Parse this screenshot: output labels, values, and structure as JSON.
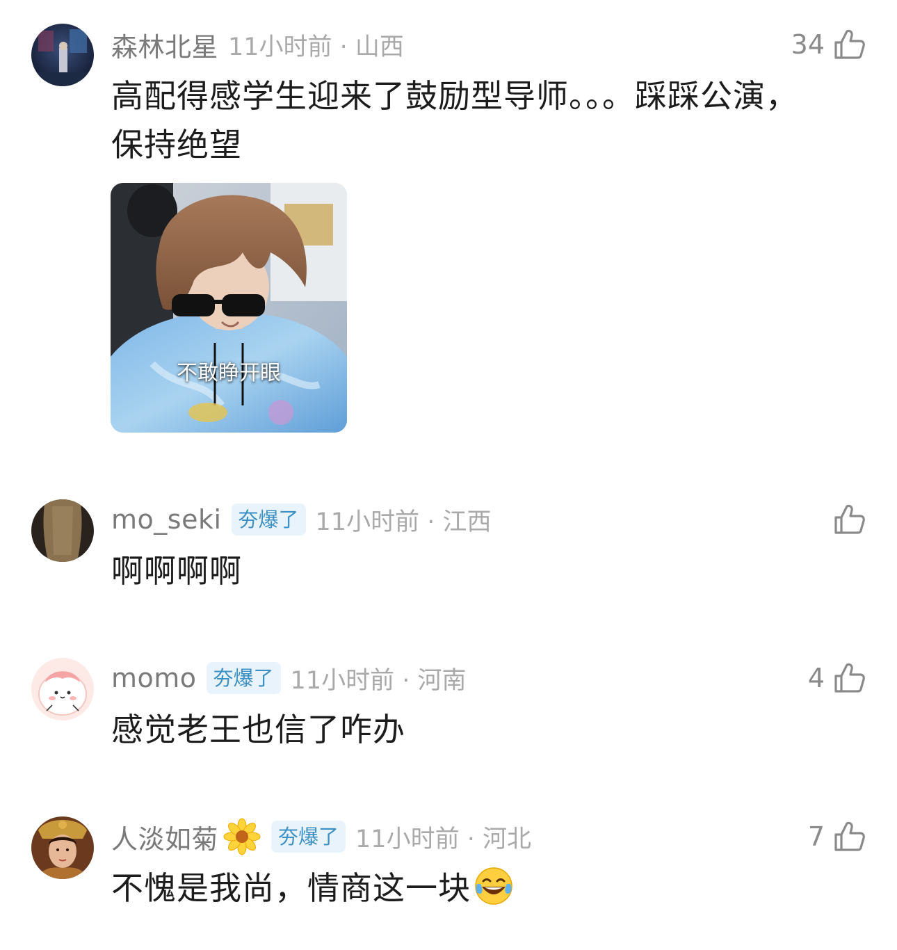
{
  "comments": [
    {
      "username": "森林北星",
      "badge": "",
      "time_location": "11小时前 · 山西",
      "likes": "34",
      "text_line1": "高配得感学生迎来了鼓励型导师。。。踩踩公演，",
      "text_line2": "保持绝望",
      "sticker": {
        "caption": "不敢睁开眼"
      }
    },
    {
      "username": "mo_seki",
      "badge": "夯爆了",
      "time_location": "11小时前 · 江西",
      "likes": "",
      "text": "啊啊啊啊"
    },
    {
      "username": "momo",
      "badge": "夯爆了",
      "time_location": "11小时前 · 河南",
      "likes": "4",
      "text": "感觉老王也信了咋办"
    },
    {
      "username": "人淡如菊",
      "username_emoji": "flower-icon",
      "badge": "夯爆了",
      "time_location": "11小时前 · 河北",
      "likes": "7",
      "text": "不愧是我尚，情商这一块",
      "text_emoji": "laughing-tears-icon"
    }
  ],
  "colors": {
    "username": "#7a7a7a",
    "time": "#a9a9a9",
    "badge_bg": "#e8f3fb",
    "badge_text": "#3d90c4",
    "content": "#1c1c1c"
  }
}
